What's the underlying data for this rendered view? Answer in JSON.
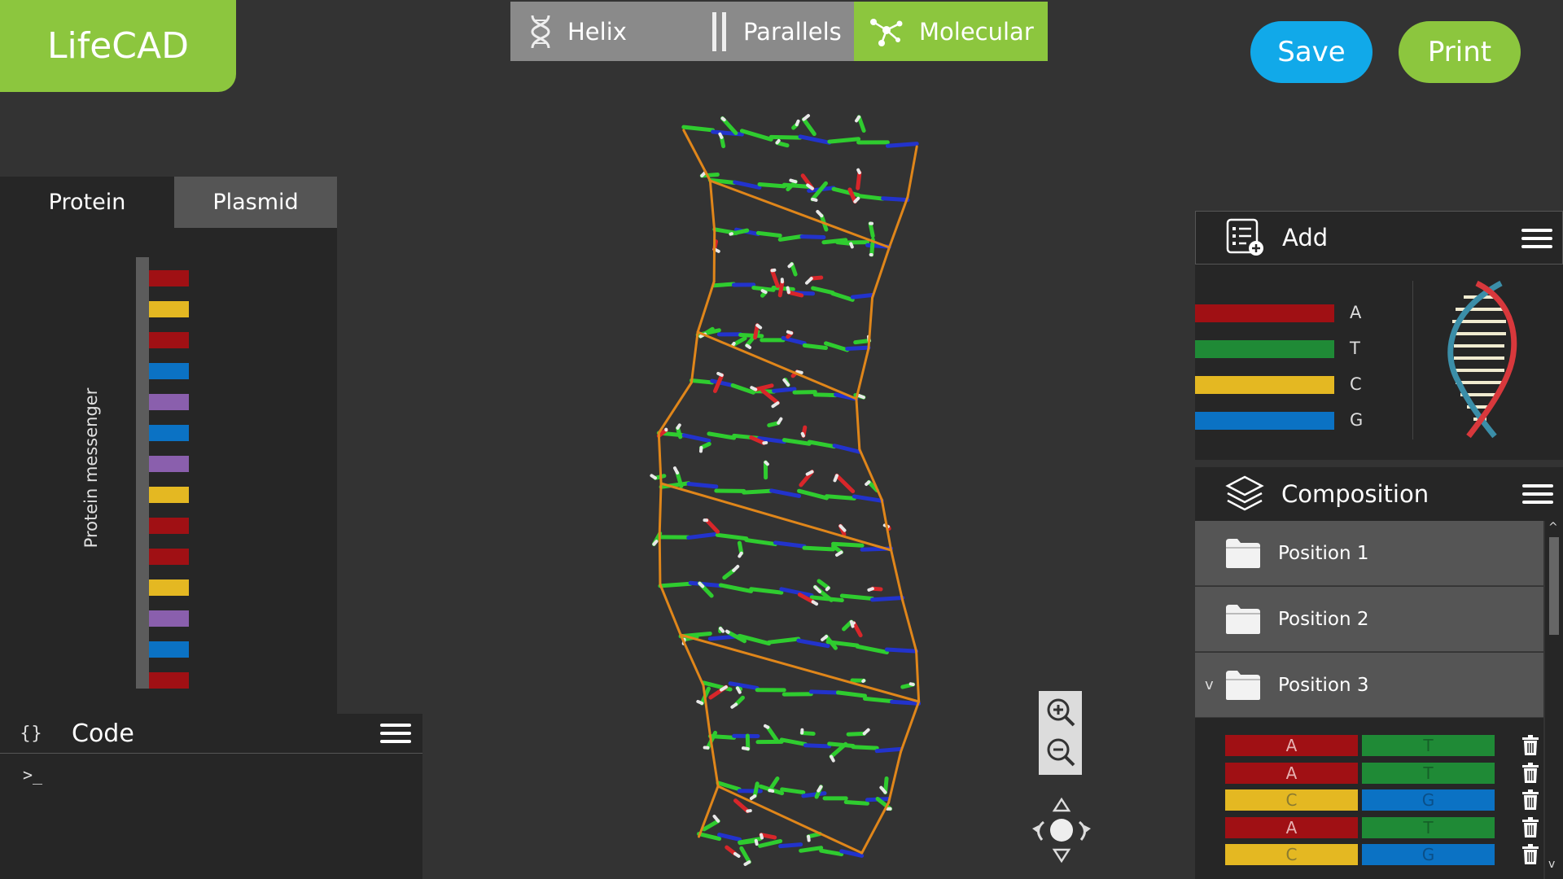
{
  "app": {
    "title": "LifeCAD"
  },
  "modes": [
    {
      "label": "Helix",
      "active": false
    },
    {
      "label": "Parallels",
      "active": false
    },
    {
      "label": "Molecular",
      "active": true
    }
  ],
  "actions": {
    "save": "Save",
    "print": "Print"
  },
  "left_panel": {
    "tabs": [
      {
        "label": "Protein",
        "active": true
      },
      {
        "label": "Plasmid",
        "active": false
      }
    ],
    "strand_label": "Protein messenger",
    "strand_colors": [
      "red",
      "yellow",
      "red",
      "blue",
      "purple",
      "blue",
      "purple",
      "yellow",
      "red",
      "red",
      "yellow",
      "purple",
      "blue",
      "red"
    ]
  },
  "code_panel": {
    "braces": "{}",
    "title": "Code",
    "prompt": ">_"
  },
  "add_panel": {
    "title": "Add",
    "bases": [
      {
        "label": "A",
        "color": "#a01014"
      },
      {
        "label": "T",
        "color": "#1f8a36"
      },
      {
        "label": "C",
        "color": "#e4b822"
      },
      {
        "label": "G",
        "color": "#0b72c4"
      }
    ]
  },
  "composition": {
    "title": "Composition",
    "positions": [
      {
        "label": "Position 1",
        "expanded": false
      },
      {
        "label": "Position 2",
        "expanded": false
      },
      {
        "label": "Position 3",
        "expanded": true
      }
    ],
    "expand_marker": "v",
    "pairs": [
      {
        "left": "A",
        "right": "T"
      },
      {
        "left": "A",
        "right": "T"
      },
      {
        "left": "C",
        "right": "G"
      },
      {
        "left": "A",
        "right": "T"
      },
      {
        "left": "C",
        "right": "G"
      }
    ],
    "scroll_up": "^",
    "scroll_down": "v"
  },
  "colors": {
    "green": "#8cc63e",
    "blue": "#11a9e9",
    "red": "#a01014",
    "dna_green": "#1f8a36",
    "yellow": "#e4b822",
    "dna_blue": "#0b72c4",
    "purple": "#8a5fad"
  }
}
